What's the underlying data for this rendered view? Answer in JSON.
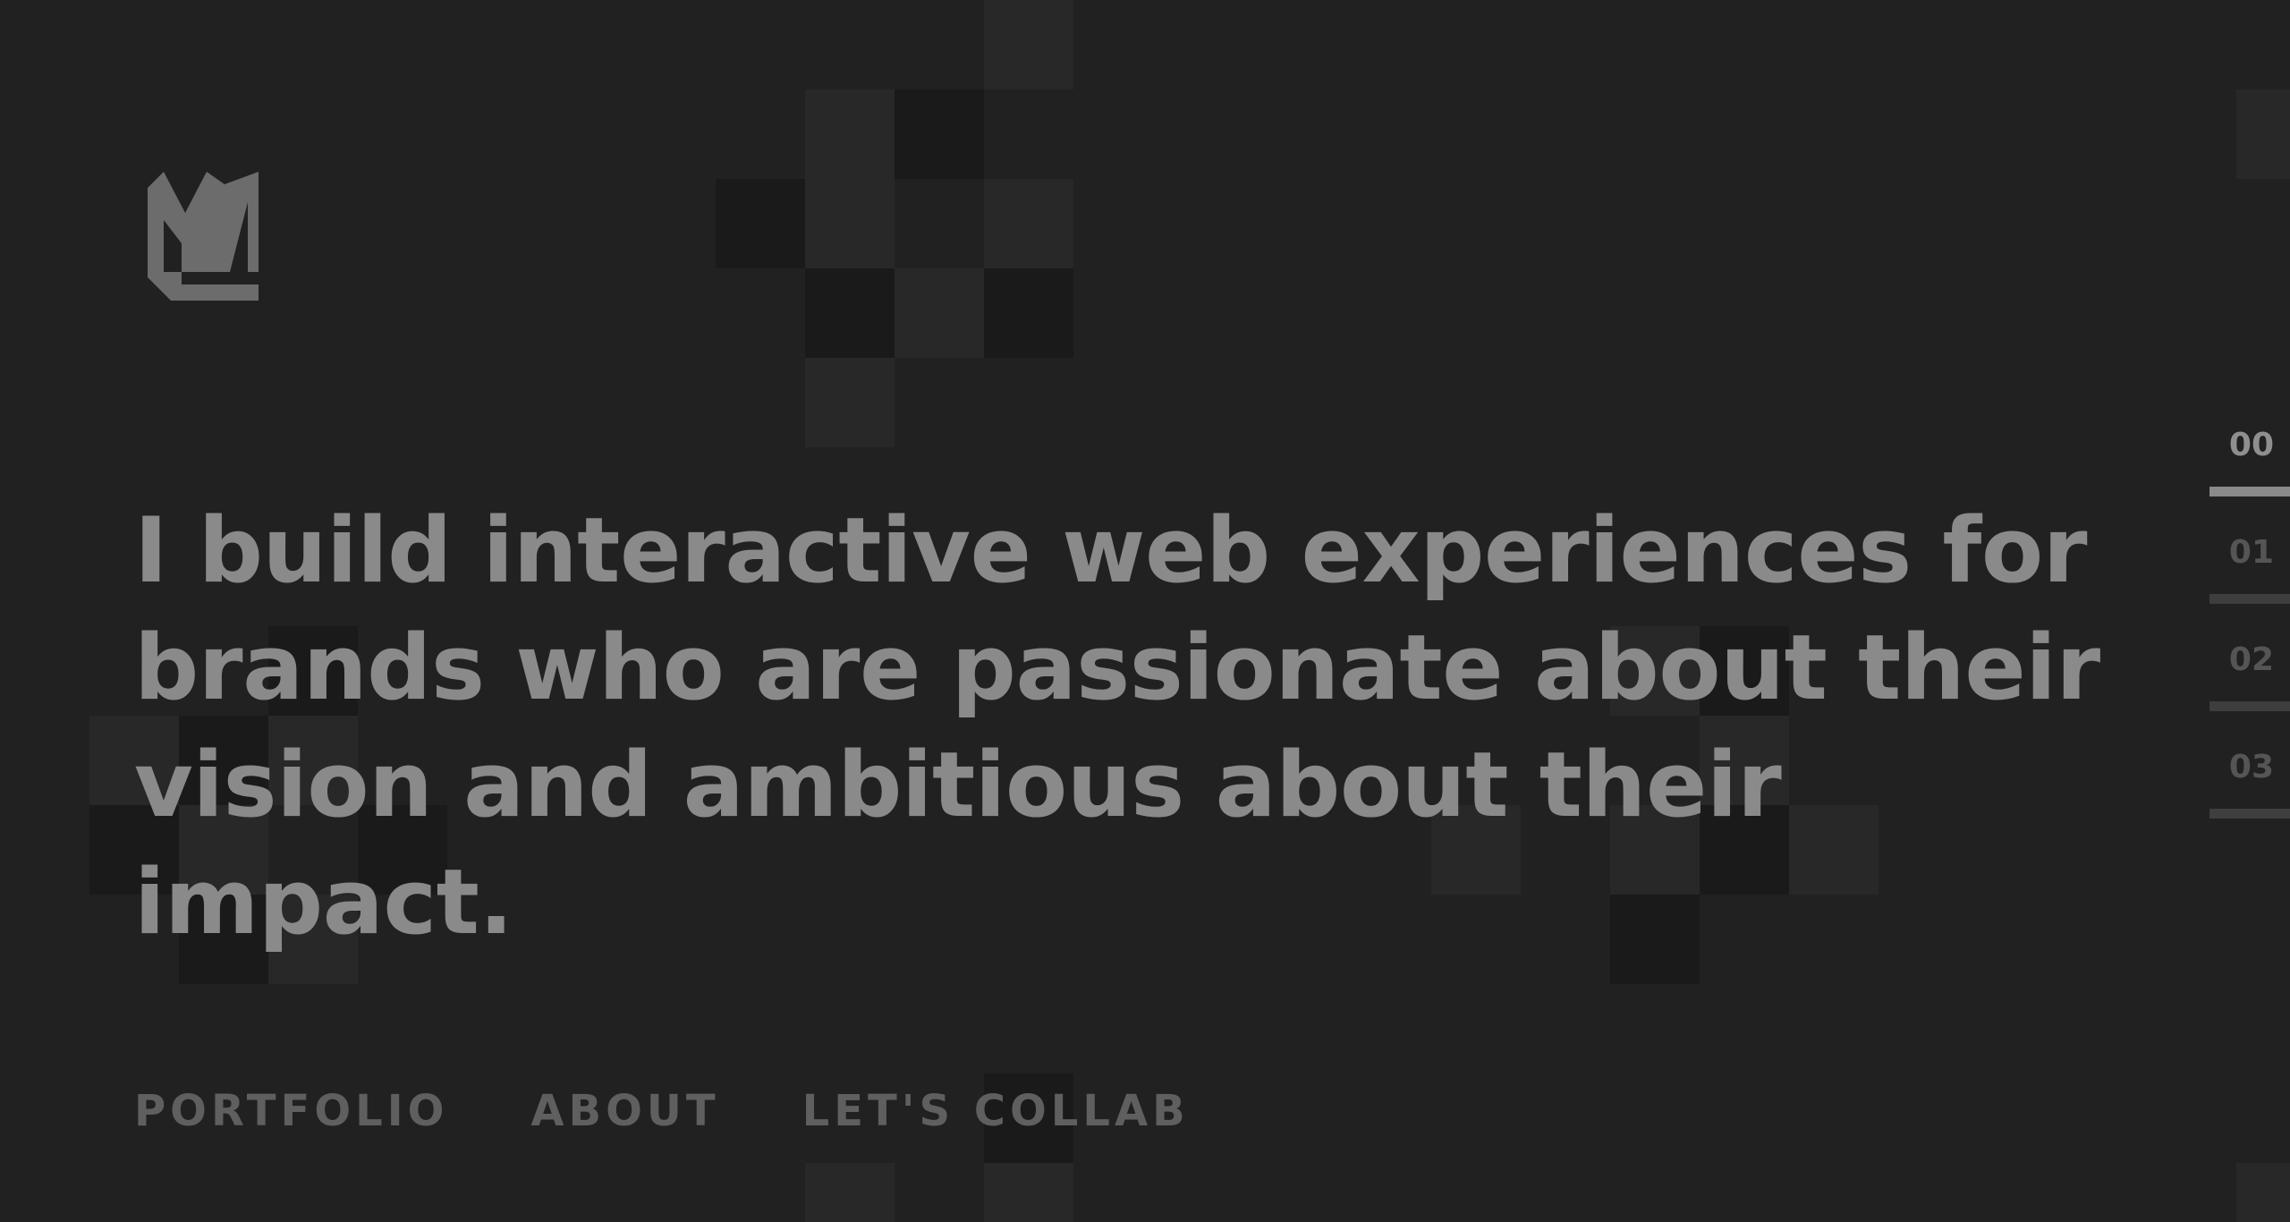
{
  "logo": {
    "icon": "monogram-m-logo-icon"
  },
  "headline": "I build interactive web experiences for brands who are passionate about their vision and ambitious about their impact.",
  "nav": {
    "portfolio": "PORTFOLIO",
    "about": "ABOUT",
    "collab": "LET'S COLLAB"
  },
  "sections": [
    {
      "label": "00",
      "active": true
    },
    {
      "label": "01",
      "active": false
    },
    {
      "label": "02",
      "active": false
    },
    {
      "label": "03",
      "active": false
    }
  ],
  "colors": {
    "background": "#212121",
    "headline": "#8a8a8a",
    "nav": "#5f5f5f",
    "accent": "#8a8a8a"
  }
}
